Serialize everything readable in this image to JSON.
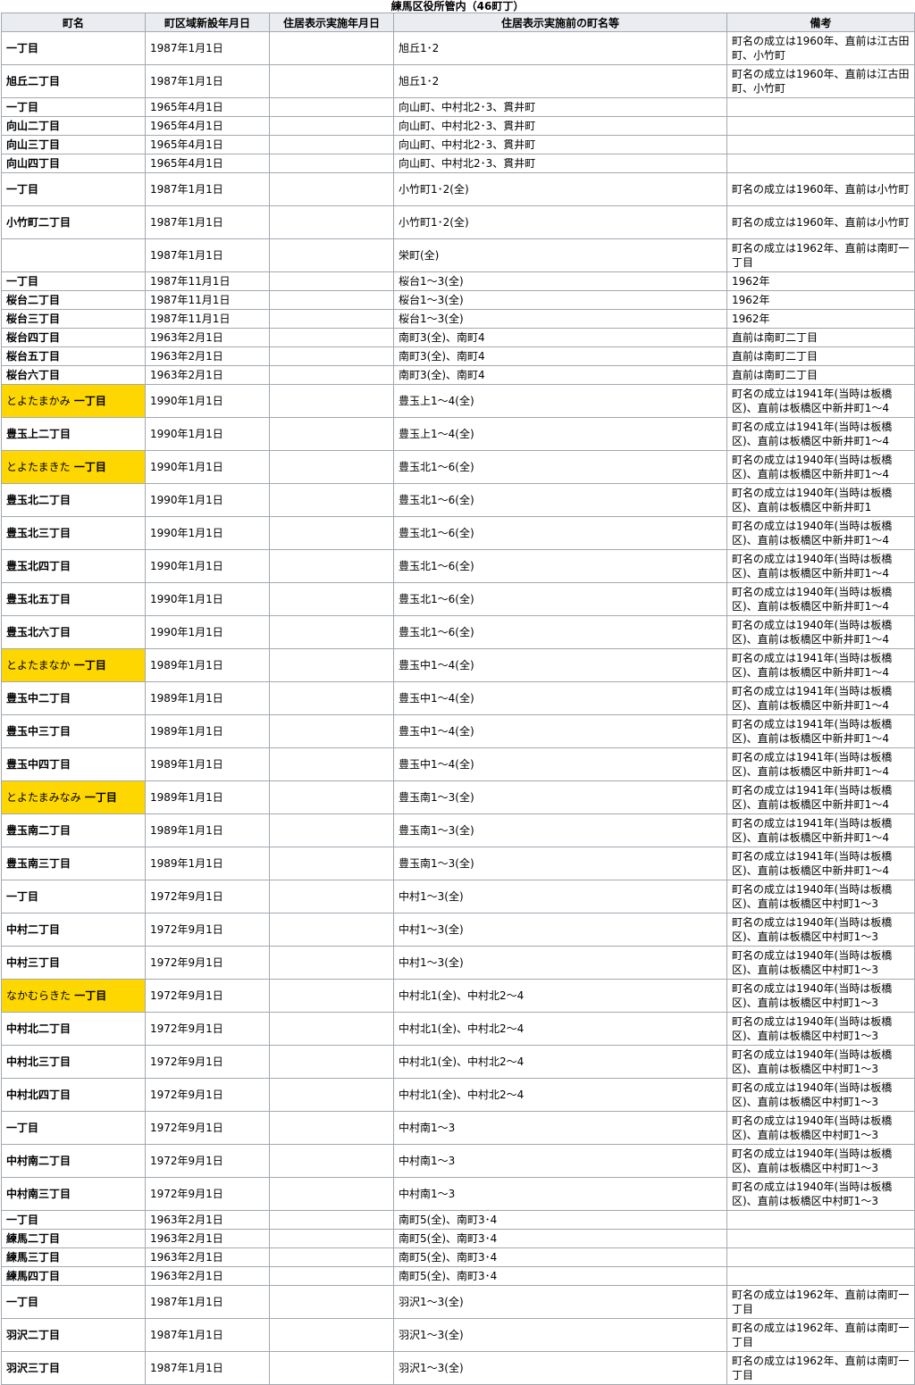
{
  "caption": "練馬区役所管内（46町丁）",
  "headers": [
    "町名",
    "町区域新設年月日",
    "住居表示実施年月日",
    "住居表示実施前の町名等",
    "備考"
  ],
  "rows": [
    {
      "kana": "",
      "name": "一丁目",
      "hl": false,
      "est": "1987年1月1日",
      "impl": "",
      "prev": "旭丘1･2",
      "note": "町名の成立は1960年、直前は江古田町、小竹町",
      "tall": true
    },
    {
      "kana": "",
      "name": "旭丘二丁目",
      "hl": false,
      "est": "1987年1月1日",
      "impl": "",
      "prev": "旭丘1･2",
      "note": "町名の成立は1960年、直前は江古田町、小竹町",
      "tall": true
    },
    {
      "kana": "",
      "name": "一丁目",
      "hl": false,
      "est": "1965年4月1日",
      "impl": "",
      "prev": "向山町、中村北2･3、貫井町",
      "note": "",
      "tall": false
    },
    {
      "kana": "",
      "name": "向山二丁目",
      "hl": false,
      "est": "1965年4月1日",
      "impl": "",
      "prev": "向山町、中村北2･3、貫井町",
      "note": "",
      "tall": false
    },
    {
      "kana": "",
      "name": "向山三丁目",
      "hl": false,
      "est": "1965年4月1日",
      "impl": "",
      "prev": "向山町、中村北2･3、貫井町",
      "note": "",
      "tall": false
    },
    {
      "kana": "",
      "name": "向山四丁目",
      "hl": false,
      "est": "1965年4月1日",
      "impl": "",
      "prev": "向山町、中村北2･3、貫井町",
      "note": "",
      "tall": false
    },
    {
      "kana": "",
      "name": "一丁目",
      "hl": false,
      "est": "1987年1月1日",
      "impl": "",
      "prev": "小竹町1･2(全)",
      "note": "町名の成立は1960年、直前は小竹町",
      "tall": true
    },
    {
      "kana": "",
      "name": "小竹町二丁目",
      "hl": false,
      "est": "1987年1月1日",
      "impl": "",
      "prev": "小竹町1･2(全)",
      "note": "町名の成立は1960年、直前は小竹町",
      "tall": true
    },
    {
      "kana": "",
      "name": "",
      "hl": false,
      "est": "1987年1月1日",
      "impl": "",
      "prev": "栄町(全)",
      "note": "町名の成立は1962年、直前は南町一丁目",
      "tall": true
    },
    {
      "kana": "",
      "name": "一丁目",
      "hl": false,
      "est": "1987年11月1日",
      "impl": "",
      "prev": "桜台1～3(全)",
      "note": "1962年",
      "tall": false
    },
    {
      "kana": "",
      "name": "桜台二丁目",
      "hl": false,
      "est": "1987年11月1日",
      "impl": "",
      "prev": "桜台1～3(全)",
      "note": "1962年",
      "tall": false
    },
    {
      "kana": "",
      "name": "桜台三丁目",
      "hl": false,
      "est": "1987年11月1日",
      "impl": "",
      "prev": "桜台1～3(全)",
      "note": "1962年",
      "tall": false
    },
    {
      "kana": "",
      "name": "桜台四丁目",
      "hl": false,
      "est": "1963年2月1日",
      "impl": "",
      "prev": "南町3(全)、南町4",
      "note": "直前は南町二丁目",
      "tall": false
    },
    {
      "kana": "",
      "name": "桜台五丁目",
      "hl": false,
      "est": "1963年2月1日",
      "impl": "",
      "prev": "南町3(全)、南町4",
      "note": "直前は南町二丁目",
      "tall": false
    },
    {
      "kana": "",
      "name": "桜台六丁目",
      "hl": false,
      "est": "1963年2月1日",
      "impl": "",
      "prev": "南町3(全)、南町4",
      "note": "直前は南町二丁目",
      "tall": false
    },
    {
      "kana": "とよたまかみ",
      "name": "一丁目",
      "hl": true,
      "est": "1990年1月1日",
      "impl": "",
      "prev": "豊玉上1～4(全)",
      "note": "町名の成立は1941年(当時は板橋区)、直前は板橋区中新井町1～4",
      "tall": true
    },
    {
      "kana": "",
      "name": "豊玉上二丁目",
      "hl": false,
      "est": "1990年1月1日",
      "impl": "",
      "prev": "豊玉上1～4(全)",
      "note": "町名の成立は1941年(当時は板橋区)、直前は板橋区中新井町1～4",
      "tall": true
    },
    {
      "kana": "とよたまきた",
      "name": "一丁目",
      "hl": true,
      "est": "1990年1月1日",
      "impl": "",
      "prev": "豊玉北1～6(全)",
      "note": "町名の成立は1940年(当時は板橋区)、直前は板橋区中新井町1～4",
      "tall": true
    },
    {
      "kana": "",
      "name": "豊玉北二丁目",
      "hl": false,
      "est": "1990年1月1日",
      "impl": "",
      "prev": "豊玉北1～6(全)",
      "note": "町名の成立は1940年(当時は板橋区)、直前は板橋区中新井町1",
      "tall": true
    },
    {
      "kana": "",
      "name": "豊玉北三丁目",
      "hl": false,
      "est": "1990年1月1日",
      "impl": "",
      "prev": "豊玉北1～6(全)",
      "note": "町名の成立は1940年(当時は板橋区)、直前は板橋区中新井町1～4",
      "tall": true
    },
    {
      "kana": "",
      "name": "豊玉北四丁目",
      "hl": false,
      "est": "1990年1月1日",
      "impl": "",
      "prev": "豊玉北1～6(全)",
      "note": "町名の成立は1940年(当時は板橋区)、直前は板橋区中新井町1～4",
      "tall": true
    },
    {
      "kana": "",
      "name": "豊玉北五丁目",
      "hl": false,
      "est": "1990年1月1日",
      "impl": "",
      "prev": "豊玉北1～6(全)",
      "note": "町名の成立は1940年(当時は板橋区)、直前は板橋区中新井町1～4",
      "tall": true
    },
    {
      "kana": "",
      "name": "豊玉北六丁目",
      "hl": false,
      "est": "1990年1月1日",
      "impl": "",
      "prev": "豊玉北1～6(全)",
      "note": "町名の成立は1940年(当時は板橋区)、直前は板橋区中新井町1～4",
      "tall": true
    },
    {
      "kana": "とよたまなか",
      "name": "一丁目",
      "hl": true,
      "est": "1989年1月1日",
      "impl": "",
      "prev": "豊玉中1～4(全)",
      "note": "町名の成立は1941年(当時は板橋区)、直前は板橋区中新井町1～4",
      "tall": true
    },
    {
      "kana": "",
      "name": "豊玉中二丁目",
      "hl": false,
      "est": "1989年1月1日",
      "impl": "",
      "prev": "豊玉中1～4(全)",
      "note": "町名の成立は1941年(当時は板橋区)、直前は板橋区中新井町1～4",
      "tall": true
    },
    {
      "kana": "",
      "name": "豊玉中三丁目",
      "hl": false,
      "est": "1989年1月1日",
      "impl": "",
      "prev": "豊玉中1～4(全)",
      "note": "町名の成立は1941年(当時は板橋区)、直前は板橋区中新井町1～4",
      "tall": true
    },
    {
      "kana": "",
      "name": "豊玉中四丁目",
      "hl": false,
      "est": "1989年1月1日",
      "impl": "",
      "prev": "豊玉中1～4(全)",
      "note": "町名の成立は1941年(当時は板橋区)、直前は板橋区中新井町1～4",
      "tall": true
    },
    {
      "kana": "とよたまみなみ",
      "name": "一丁目",
      "hl": true,
      "est": "1989年1月1日",
      "impl": "",
      "prev": "豊玉南1～3(全)",
      "note": "町名の成立は1941年(当時は板橋区)、直前は板橋区中新井町1～4",
      "tall": true
    },
    {
      "kana": "",
      "name": "豊玉南二丁目",
      "hl": false,
      "est": "1989年1月1日",
      "impl": "",
      "prev": "豊玉南1～3(全)",
      "note": "町名の成立は1941年(当時は板橋区)、直前は板橋区中新井町1～4",
      "tall": true
    },
    {
      "kana": "",
      "name": "豊玉南三丁目",
      "hl": false,
      "est": "1989年1月1日",
      "impl": "",
      "prev": "豊玉南1～3(全)",
      "note": "町名の成立は1941年(当時は板橋区)、直前は板橋区中新井町1～4",
      "tall": true
    },
    {
      "kana": "",
      "name": "一丁目",
      "hl": false,
      "est": "1972年9月1日",
      "impl": "",
      "prev": "中村1～3(全)",
      "note": "町名の成立は1940年(当時は板橋区)、直前は板橋区中村町1～3",
      "tall": true
    },
    {
      "kana": "",
      "name": "中村二丁目",
      "hl": false,
      "est": "1972年9月1日",
      "impl": "",
      "prev": "中村1～3(全)",
      "note": "町名の成立は1940年(当時は板橋区)、直前は板橋区中村町1～3",
      "tall": true
    },
    {
      "kana": "",
      "name": "中村三丁目",
      "hl": false,
      "est": "1972年9月1日",
      "impl": "",
      "prev": "中村1～3(全)",
      "note": "町名の成立は1940年(当時は板橋区)、直前は板橋区中村町1～3",
      "tall": true
    },
    {
      "kana": "なかむらきた",
      "name": "一丁目",
      "hl": true,
      "est": "1972年9月1日",
      "impl": "",
      "prev": "中村北1(全)、中村北2～4",
      "note": "町名の成立は1940年(当時は板橋区)、直前は板橋区中村町1～3",
      "tall": true
    },
    {
      "kana": "",
      "name": "中村北二丁目",
      "hl": false,
      "est": "1972年9月1日",
      "impl": "",
      "prev": "中村北1(全)、中村北2～4",
      "note": "町名の成立は1940年(当時は板橋区)、直前は板橋区中村町1～3",
      "tall": true
    },
    {
      "kana": "",
      "name": "中村北三丁目",
      "hl": false,
      "est": "1972年9月1日",
      "impl": "",
      "prev": "中村北1(全)、中村北2～4",
      "note": "町名の成立は1940年(当時は板橋区)、直前は板橋区中村町1～3",
      "tall": true
    },
    {
      "kana": "",
      "name": "中村北四丁目",
      "hl": false,
      "est": "1972年9月1日",
      "impl": "",
      "prev": "中村北1(全)、中村北2～4",
      "note": "町名の成立は1940年(当時は板橋区)、直前は板橋区中村町1～3",
      "tall": true
    },
    {
      "kana": "",
      "name": "一丁目",
      "hl": false,
      "est": "1972年9月1日",
      "impl": "",
      "prev": "中村南1～3",
      "note": "町名の成立は1940年(当時は板橋区)、直前は板橋区中村町1～3",
      "tall": true
    },
    {
      "kana": "",
      "name": "中村南二丁目",
      "hl": false,
      "est": "1972年9月1日",
      "impl": "",
      "prev": "中村南1～3",
      "note": "町名の成立は1940年(当時は板橋区)、直前は板橋区中村町1～3",
      "tall": true
    },
    {
      "kana": "",
      "name": "中村南三丁目",
      "hl": false,
      "est": "1972年9月1日",
      "impl": "",
      "prev": "中村南1～3",
      "note": "町名の成立は1940年(当時は板橋区)、直前は板橋区中村町1～3",
      "tall": true
    },
    {
      "kana": "",
      "name": "一丁目",
      "hl": false,
      "est": "1963年2月1日",
      "impl": "",
      "prev": "南町5(全)、南町3･4",
      "note": "",
      "tall": false
    },
    {
      "kana": "",
      "name": "練馬二丁目",
      "hl": false,
      "est": "1963年2月1日",
      "impl": "",
      "prev": "南町5(全)、南町3･4",
      "note": "",
      "tall": false
    },
    {
      "kana": "",
      "name": "練馬三丁目",
      "hl": false,
      "est": "1963年2月1日",
      "impl": "",
      "prev": "南町5(全)、南町3･4",
      "note": "",
      "tall": false
    },
    {
      "kana": "",
      "name": "練馬四丁目",
      "hl": false,
      "est": "1963年2月1日",
      "impl": "",
      "prev": "南町5(全)、南町3･4",
      "note": "",
      "tall": false
    },
    {
      "kana": "",
      "name": "一丁目",
      "hl": false,
      "est": "1987年1月1日",
      "impl": "",
      "prev": "羽沢1～3(全)",
      "note": "町名の成立は1962年、直前は南町一丁目",
      "tall": true
    },
    {
      "kana": "",
      "name": "羽沢二丁目",
      "hl": false,
      "est": "1987年1月1日",
      "impl": "",
      "prev": "羽沢1～3(全)",
      "note": "町名の成立は1962年、直前は南町一丁目",
      "tall": true
    },
    {
      "kana": "",
      "name": "羽沢三丁目",
      "hl": false,
      "est": "1987年1月1日",
      "impl": "",
      "prev": "羽沢1～3(全)",
      "note": "町名の成立は1962年、直前は南町一丁目",
      "tall": true
    }
  ]
}
